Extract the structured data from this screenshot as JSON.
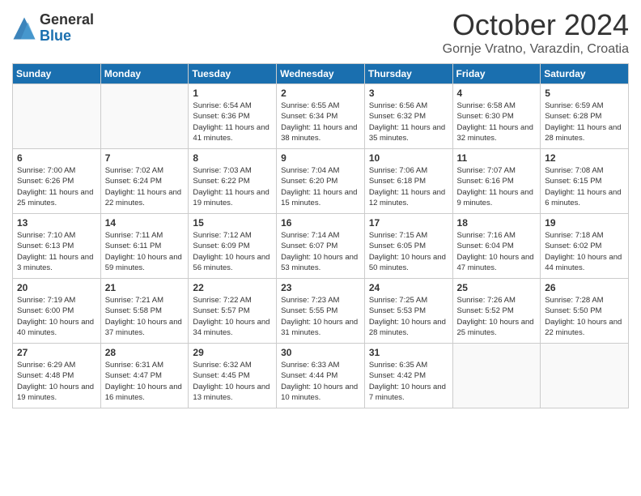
{
  "header": {
    "logo_general": "General",
    "logo_blue": "Blue",
    "month_title": "October 2024",
    "location": "Gornje Vratno, Varazdin, Croatia"
  },
  "days_of_week": [
    "Sunday",
    "Monday",
    "Tuesday",
    "Wednesday",
    "Thursday",
    "Friday",
    "Saturday"
  ],
  "weeks": [
    [
      {
        "day": "",
        "info": ""
      },
      {
        "day": "",
        "info": ""
      },
      {
        "day": "1",
        "info": "Sunrise: 6:54 AM\nSunset: 6:36 PM\nDaylight: 11 hours and 41 minutes."
      },
      {
        "day": "2",
        "info": "Sunrise: 6:55 AM\nSunset: 6:34 PM\nDaylight: 11 hours and 38 minutes."
      },
      {
        "day": "3",
        "info": "Sunrise: 6:56 AM\nSunset: 6:32 PM\nDaylight: 11 hours and 35 minutes."
      },
      {
        "day": "4",
        "info": "Sunrise: 6:58 AM\nSunset: 6:30 PM\nDaylight: 11 hours and 32 minutes."
      },
      {
        "day": "5",
        "info": "Sunrise: 6:59 AM\nSunset: 6:28 PM\nDaylight: 11 hours and 28 minutes."
      }
    ],
    [
      {
        "day": "6",
        "info": "Sunrise: 7:00 AM\nSunset: 6:26 PM\nDaylight: 11 hours and 25 minutes."
      },
      {
        "day": "7",
        "info": "Sunrise: 7:02 AM\nSunset: 6:24 PM\nDaylight: 11 hours and 22 minutes."
      },
      {
        "day": "8",
        "info": "Sunrise: 7:03 AM\nSunset: 6:22 PM\nDaylight: 11 hours and 19 minutes."
      },
      {
        "day": "9",
        "info": "Sunrise: 7:04 AM\nSunset: 6:20 PM\nDaylight: 11 hours and 15 minutes."
      },
      {
        "day": "10",
        "info": "Sunrise: 7:06 AM\nSunset: 6:18 PM\nDaylight: 11 hours and 12 minutes."
      },
      {
        "day": "11",
        "info": "Sunrise: 7:07 AM\nSunset: 6:16 PM\nDaylight: 11 hours and 9 minutes."
      },
      {
        "day": "12",
        "info": "Sunrise: 7:08 AM\nSunset: 6:15 PM\nDaylight: 11 hours and 6 minutes."
      }
    ],
    [
      {
        "day": "13",
        "info": "Sunrise: 7:10 AM\nSunset: 6:13 PM\nDaylight: 11 hours and 3 minutes."
      },
      {
        "day": "14",
        "info": "Sunrise: 7:11 AM\nSunset: 6:11 PM\nDaylight: 10 hours and 59 minutes."
      },
      {
        "day": "15",
        "info": "Sunrise: 7:12 AM\nSunset: 6:09 PM\nDaylight: 10 hours and 56 minutes."
      },
      {
        "day": "16",
        "info": "Sunrise: 7:14 AM\nSunset: 6:07 PM\nDaylight: 10 hours and 53 minutes."
      },
      {
        "day": "17",
        "info": "Sunrise: 7:15 AM\nSunset: 6:05 PM\nDaylight: 10 hours and 50 minutes."
      },
      {
        "day": "18",
        "info": "Sunrise: 7:16 AM\nSunset: 6:04 PM\nDaylight: 10 hours and 47 minutes."
      },
      {
        "day": "19",
        "info": "Sunrise: 7:18 AM\nSunset: 6:02 PM\nDaylight: 10 hours and 44 minutes."
      }
    ],
    [
      {
        "day": "20",
        "info": "Sunrise: 7:19 AM\nSunset: 6:00 PM\nDaylight: 10 hours and 40 minutes."
      },
      {
        "day": "21",
        "info": "Sunrise: 7:21 AM\nSunset: 5:58 PM\nDaylight: 10 hours and 37 minutes."
      },
      {
        "day": "22",
        "info": "Sunrise: 7:22 AM\nSunset: 5:57 PM\nDaylight: 10 hours and 34 minutes."
      },
      {
        "day": "23",
        "info": "Sunrise: 7:23 AM\nSunset: 5:55 PM\nDaylight: 10 hours and 31 minutes."
      },
      {
        "day": "24",
        "info": "Sunrise: 7:25 AM\nSunset: 5:53 PM\nDaylight: 10 hours and 28 minutes."
      },
      {
        "day": "25",
        "info": "Sunrise: 7:26 AM\nSunset: 5:52 PM\nDaylight: 10 hours and 25 minutes."
      },
      {
        "day": "26",
        "info": "Sunrise: 7:28 AM\nSunset: 5:50 PM\nDaylight: 10 hours and 22 minutes."
      }
    ],
    [
      {
        "day": "27",
        "info": "Sunrise: 6:29 AM\nSunset: 4:48 PM\nDaylight: 10 hours and 19 minutes."
      },
      {
        "day": "28",
        "info": "Sunrise: 6:31 AM\nSunset: 4:47 PM\nDaylight: 10 hours and 16 minutes."
      },
      {
        "day": "29",
        "info": "Sunrise: 6:32 AM\nSunset: 4:45 PM\nDaylight: 10 hours and 13 minutes."
      },
      {
        "day": "30",
        "info": "Sunrise: 6:33 AM\nSunset: 4:44 PM\nDaylight: 10 hours and 10 minutes."
      },
      {
        "day": "31",
        "info": "Sunrise: 6:35 AM\nSunset: 4:42 PM\nDaylight: 10 hours and 7 minutes."
      },
      {
        "day": "",
        "info": ""
      },
      {
        "day": "",
        "info": ""
      }
    ]
  ]
}
